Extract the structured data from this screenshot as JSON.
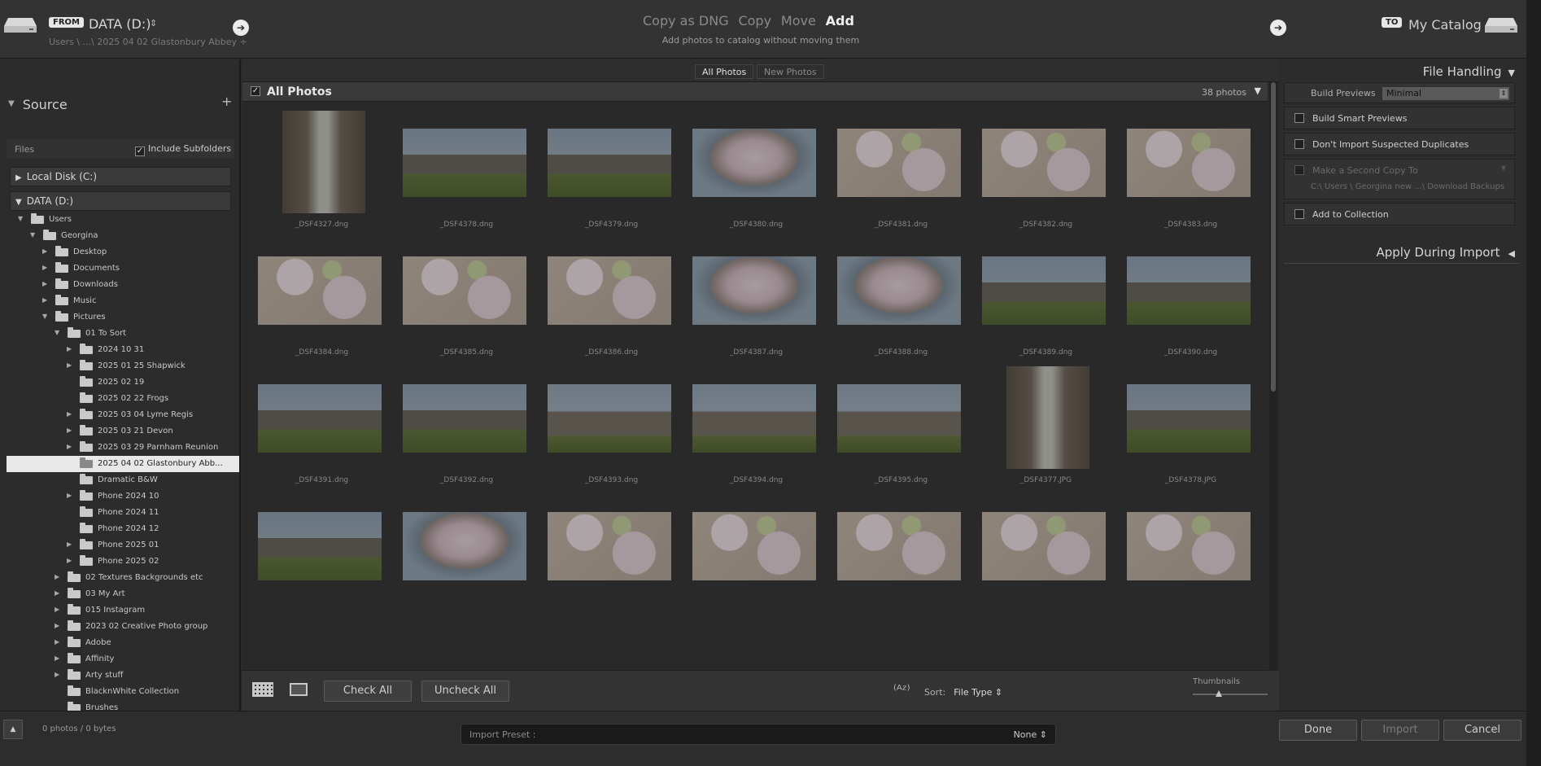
{
  "header": {
    "from_badge": "FROM",
    "source_name": "DATA (D:)",
    "source_caret": "⇕",
    "source_path": "Users \\ ...\\ 2025 04 02 Glastonbury Abbey ÷",
    "modes": [
      "Copy as DNG",
      "Copy",
      "Move",
      "Add"
    ],
    "selected_mode": "Add",
    "subtitle": "Add photos to catalog without moving them",
    "to_badge": "TO",
    "destination_name": "My Catalog",
    "arrow_glyph": "➔"
  },
  "left": {
    "source_title": "Source",
    "files_label": "Files",
    "include_subfolders_label": "Include Subfolders",
    "include_subfolders_checked": true,
    "volumes": [
      {
        "label": "Local Disk (C:)",
        "expanded": false
      },
      {
        "label": "DATA (D:)",
        "expanded": true
      }
    ],
    "tree": [
      {
        "label": "Users",
        "depth": 0,
        "twisty": "open"
      },
      {
        "label": "Georgina",
        "depth": 1,
        "twisty": "open"
      },
      {
        "label": "Desktop",
        "depth": 2,
        "twisty": "closed"
      },
      {
        "label": "Documents",
        "depth": 2,
        "twisty": "closed"
      },
      {
        "label": "Downloads",
        "depth": 2,
        "twisty": "closed"
      },
      {
        "label": "Music",
        "depth": 2,
        "twisty": "closed"
      },
      {
        "label": "Pictures",
        "depth": 2,
        "twisty": "open"
      },
      {
        "label": "01 To Sort",
        "depth": 3,
        "twisty": "open"
      },
      {
        "label": "2024 10 31",
        "depth": 4,
        "twisty": "closed"
      },
      {
        "label": "2025 01 25 Shapwick",
        "depth": 4,
        "twisty": "closed"
      },
      {
        "label": "2025 02 19",
        "depth": 4,
        "twisty": "none"
      },
      {
        "label": "2025 02 22 Frogs",
        "depth": 4,
        "twisty": "none"
      },
      {
        "label": "2025 03 04 Lyme Regis",
        "depth": 4,
        "twisty": "closed"
      },
      {
        "label": "2025 03 21 Devon",
        "depth": 4,
        "twisty": "closed"
      },
      {
        "label": "2025 03 29 Parnham Reunion",
        "depth": 4,
        "twisty": "closed"
      },
      {
        "label": "2025 04 02 Glastonbury Abb...",
        "depth": 4,
        "twisty": "none",
        "selected": true
      },
      {
        "label": "Dramatic B&W",
        "depth": 4,
        "twisty": "none"
      },
      {
        "label": "Phone 2024 10",
        "depth": 4,
        "twisty": "closed"
      },
      {
        "label": "Phone 2024 11",
        "depth": 4,
        "twisty": "none"
      },
      {
        "label": "Phone 2024 12",
        "depth": 4,
        "twisty": "none"
      },
      {
        "label": "Phone 2025 01",
        "depth": 4,
        "twisty": "closed"
      },
      {
        "label": "Phone 2025 02",
        "depth": 4,
        "twisty": "closed"
      },
      {
        "label": "02 Textures Backgrounds etc",
        "depth": 3,
        "twisty": "closed"
      },
      {
        "label": "03 My Art",
        "depth": 3,
        "twisty": "closed"
      },
      {
        "label": "015 Instagram",
        "depth": 3,
        "twisty": "closed"
      },
      {
        "label": "2023 02 Creative Photo group",
        "depth": 3,
        "twisty": "closed"
      },
      {
        "label": "Adobe",
        "depth": 3,
        "twisty": "closed"
      },
      {
        "label": "Affinity",
        "depth": 3,
        "twisty": "closed"
      },
      {
        "label": "Arty stuff",
        "depth": 3,
        "twisty": "closed"
      },
      {
        "label": "BlacknWhite Collection",
        "depth": 3,
        "twisty": "none"
      },
      {
        "label": "Brushes",
        "depth": 3,
        "twisty": "none"
      }
    ]
  },
  "center": {
    "tabs": [
      "All Photos",
      "New Photos"
    ],
    "all_photos_title": "All Photos",
    "photo_count": "38 photos",
    "photos": [
      {
        "name": "_DSF4327.dng",
        "kind": "arch",
        "portrait": true
      },
      {
        "name": "_DSF4378.dng",
        "kind": "ruin"
      },
      {
        "name": "_DSF4379.dng",
        "kind": "ruin"
      },
      {
        "name": "_DSF4380.dng",
        "kind": "tree1"
      },
      {
        "name": "_DSF4381.dng",
        "kind": "bloss"
      },
      {
        "name": "_DSF4382.dng",
        "kind": "bloss"
      },
      {
        "name": "_DSF4383.dng",
        "kind": "bloss"
      },
      {
        "name": "_DSF4384.dng",
        "kind": "bloss"
      },
      {
        "name": "_DSF4385.dng",
        "kind": "bloss"
      },
      {
        "name": "_DSF4386.dng",
        "kind": "bloss"
      },
      {
        "name": "_DSF4387.dng",
        "kind": "tree1"
      },
      {
        "name": "_DSF4388.dng",
        "kind": "tree1"
      },
      {
        "name": "_DSF4389.dng",
        "kind": "ruin"
      },
      {
        "name": "_DSF4390.dng",
        "kind": "ruin"
      },
      {
        "name": "_DSF4391.dng",
        "kind": "ruin"
      },
      {
        "name": "_DSF4392.dng",
        "kind": "ruin"
      },
      {
        "name": "_DSF4393.dng",
        "kind": "tower"
      },
      {
        "name": "_DSF4394.dng",
        "kind": "tower"
      },
      {
        "name": "_DSF4395.dng",
        "kind": "tower"
      },
      {
        "name": "_DSF4377.JPG",
        "kind": "arch",
        "portrait": true
      },
      {
        "name": "_DSF4378.JPG",
        "kind": "ruin"
      },
      {
        "name": "",
        "kind": "ruin"
      },
      {
        "name": "",
        "kind": "tree1"
      },
      {
        "name": "",
        "kind": "bloss"
      },
      {
        "name": "",
        "kind": "bloss"
      },
      {
        "name": "",
        "kind": "bloss"
      },
      {
        "name": "",
        "kind": "bloss"
      },
      {
        "name": "",
        "kind": "bloss"
      }
    ],
    "check_all_label": "Check All",
    "uncheck_all_label": "Uncheck All",
    "sort_label": "Sort:",
    "sort_value": "File Type ⇕",
    "az_glyph": "⁽ᴬᶻ⁾",
    "thumbnails_label": "Thumbnails"
  },
  "right": {
    "file_handling_title": "File Handling",
    "build_previews_label": "Build Previews",
    "build_previews_value": "Minimal",
    "build_smart_previews_label": "Build Smart Previews",
    "dont_import_duplicates_label": "Don't Import Suspected Duplicates",
    "second_copy_label": "Make a Second Copy To",
    "second_copy_path": "C:\\ Users \\ Georgina new ...\\ Download Backups",
    "add_to_collection_label": "Add to Collection",
    "apply_during_import_title": "Apply During Import"
  },
  "footer": {
    "up_glyph": "▲",
    "photo_bytes": "0 photos / 0 bytes",
    "import_preset_label": "Import Preset :",
    "import_preset_value": "None ⇕",
    "done_label": "Done",
    "import_label": "Import",
    "cancel_label": "Cancel"
  }
}
